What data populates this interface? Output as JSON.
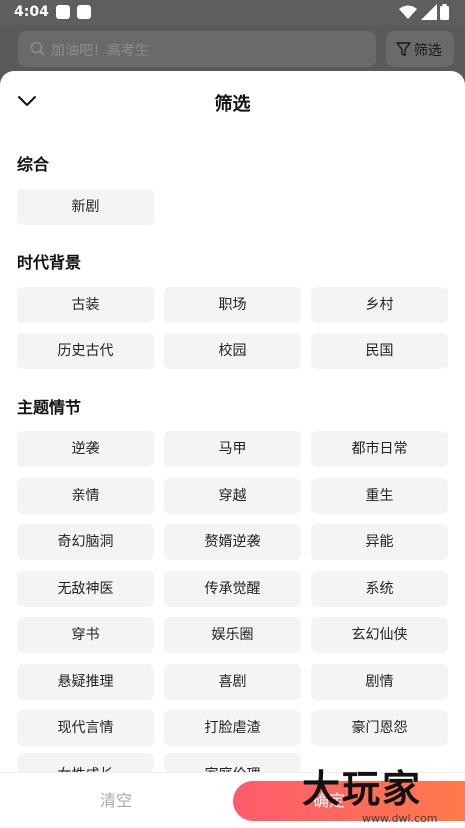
{
  "status_bar": {
    "time": "4:04"
  },
  "background": {
    "search_placeholder": "加油吧！高考生",
    "filter_label": "筛选"
  },
  "sheet": {
    "title": "筛选",
    "sections": [
      {
        "title": "综合",
        "chips": [
          "新剧"
        ]
      },
      {
        "title": "时代背景",
        "chips": [
          "古装",
          "职场",
          "乡村",
          "历史古代",
          "校园",
          "民国"
        ]
      },
      {
        "title": "主题情节",
        "chips": [
          "逆袭",
          "马甲",
          "都市日常",
          "亲情",
          "穿越",
          "重生",
          "奇幻脑洞",
          "赘婿逆袭",
          "异能",
          "无敌神医",
          "传承觉醒",
          "系统",
          "穿书",
          "娱乐圈",
          "玄幻仙侠",
          "悬疑推理",
          "喜剧",
          "剧情",
          "现代言情",
          "打脸虐渣",
          "豪门恩怨",
          "女性成长",
          "家庭伦理"
        ]
      }
    ]
  },
  "bottom": {
    "clear_label": "清空",
    "confirm_label": "确定"
  },
  "watermark": {
    "text": "大玩家",
    "sub": "www.dwl.com"
  }
}
